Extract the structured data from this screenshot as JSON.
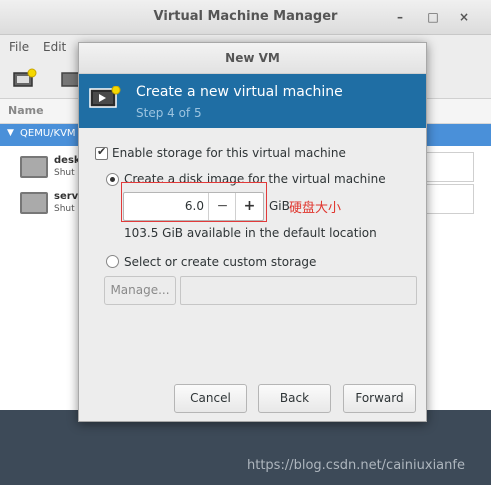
{
  "main_window": {
    "title": "Virtual Machine Manager",
    "menu": [
      "File",
      "Edit"
    ],
    "list_header": "Name",
    "connection": "QEMU/KVM",
    "vms": [
      {
        "name": "desk",
        "status": "Shut"
      },
      {
        "name": "serve",
        "status": "Shut"
      }
    ],
    "window_buttons": {
      "minimize": "–",
      "maximize": "□",
      "close": "×"
    }
  },
  "dialog": {
    "title": "New VM",
    "header_title": "Create a new virtual machine",
    "header_step": "Step 4 of 5",
    "enable_storage_label": "Enable storage for this virtual machine",
    "enable_storage_checked": true,
    "create_disk_label": "Create a disk image for the virtual machine",
    "create_disk_selected": true,
    "disk_size_value": "6.0",
    "minus_label": "−",
    "plus_label": "+",
    "disk_unit": "GiB",
    "annotation": "硬盘大小",
    "available_text": "103.5 GiB available in the default location",
    "custom_storage_label": "Select or create custom storage",
    "custom_storage_selected": false,
    "manage_label": "Manage...",
    "storage_path_value": "",
    "cancel_label": "Cancel",
    "back_label": "Back",
    "forward_label": "Forward"
  },
  "watermark": "https://blog.csdn.net/cainiuxianfe",
  "colors": {
    "header_bg": "#1f6ea4",
    "selection": "#4a90d9",
    "annotation": "#e0352d"
  }
}
